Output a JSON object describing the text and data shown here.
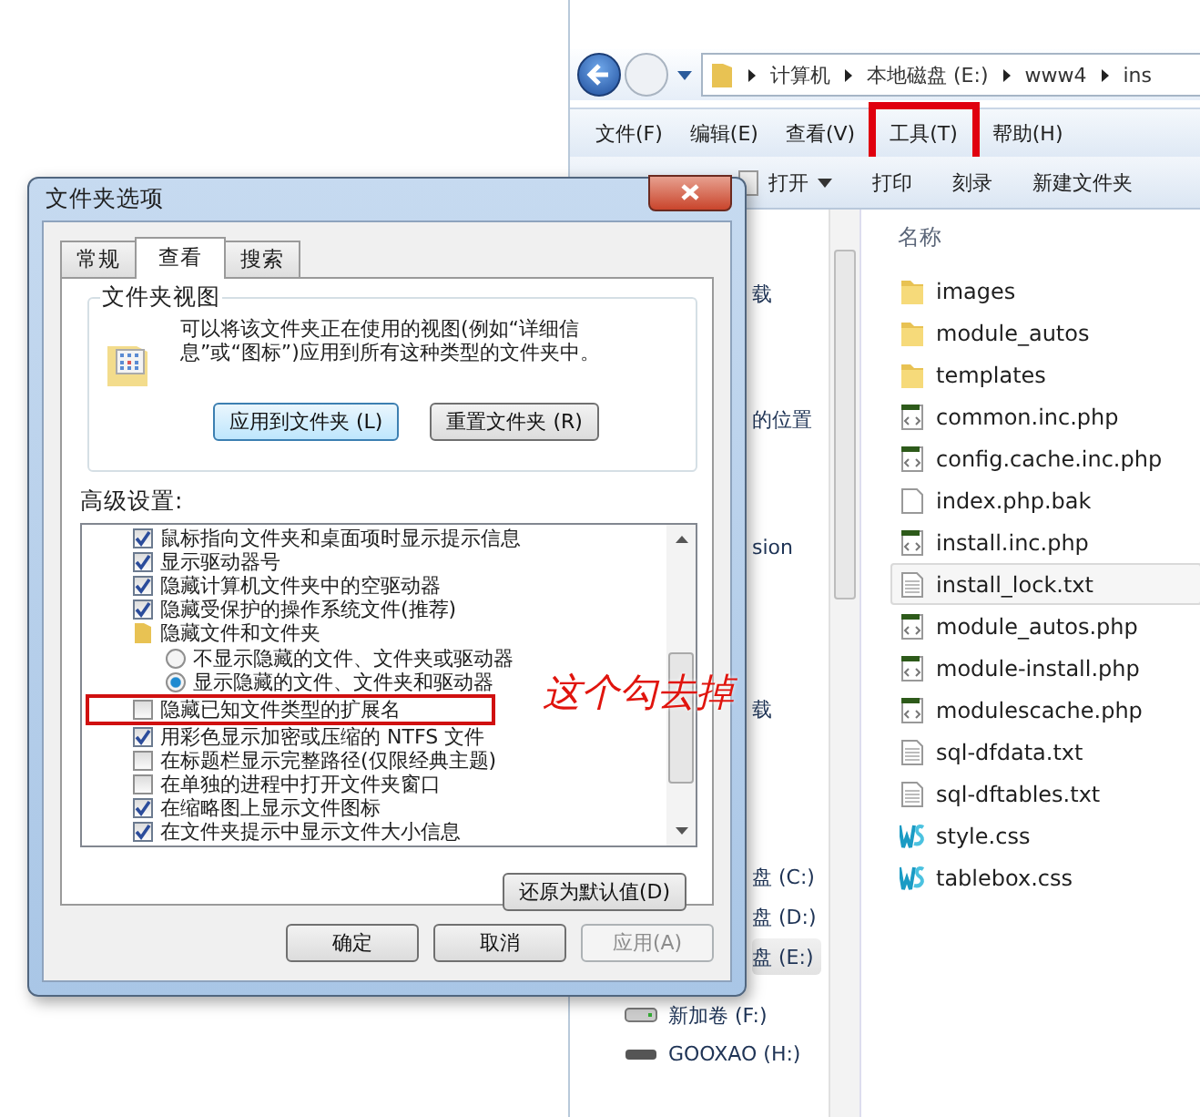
{
  "explorer": {
    "breadcrumb": [
      "计算机",
      "本地磁盘 (E:)",
      "www4",
      "ins"
    ],
    "menu": [
      {
        "label": "文件(F)",
        "highlighted": false
      },
      {
        "label": "编辑(E)",
        "highlighted": false
      },
      {
        "label": "查看(V)",
        "highlighted": false
      },
      {
        "label": "工具(T)",
        "highlighted": true
      },
      {
        "label": "帮助(H)",
        "highlighted": false
      }
    ],
    "toolbar": [
      {
        "label": "打开",
        "dropdown": true
      },
      {
        "label": "打印",
        "dropdown": false
      },
      {
        "label": "刻录",
        "dropdown": false
      },
      {
        "label": "新建文件夹",
        "dropdown": false
      }
    ],
    "nav_items": [
      {
        "label": "载",
        "kind": "text",
        "selected": false
      },
      {
        "label": "的位置",
        "kind": "text",
        "selected": false
      },
      {
        "label": "sion",
        "kind": "text",
        "selected": false
      },
      {
        "label": "载",
        "kind": "text",
        "selected": false
      },
      {
        "label": "盘 (C:)",
        "kind": "text",
        "selected": false
      },
      {
        "label": "盘 (D:)",
        "kind": "text",
        "selected": false
      },
      {
        "label": "盘 (E:)",
        "kind": "text",
        "selected": true
      },
      {
        "label": "新加卷 (F:)",
        "kind": "drive",
        "selected": false
      },
      {
        "label": "GOOXAO (H:)",
        "kind": "removable",
        "selected": false
      }
    ],
    "column_header": "名称",
    "files": [
      {
        "name": "images",
        "kind": "folder",
        "selected": false
      },
      {
        "name": "module_autos",
        "kind": "folder",
        "selected": false
      },
      {
        "name": "templates",
        "kind": "folder",
        "selected": false
      },
      {
        "name": "common.inc.php",
        "kind": "php",
        "selected": false
      },
      {
        "name": "config.cache.inc.php",
        "kind": "php",
        "selected": false
      },
      {
        "name": "index.php.bak",
        "kind": "blank",
        "selected": false
      },
      {
        "name": "install.inc.php",
        "kind": "php",
        "selected": false
      },
      {
        "name": "install_lock.txt",
        "kind": "text",
        "selected": true
      },
      {
        "name": "module_autos.php",
        "kind": "php",
        "selected": false
      },
      {
        "name": "module-install.php",
        "kind": "php",
        "selected": false
      },
      {
        "name": "modulescache.php",
        "kind": "php",
        "selected": false
      },
      {
        "name": "sql-dfdata.txt",
        "kind": "text",
        "selected": false
      },
      {
        "name": "sql-dftables.txt",
        "kind": "text",
        "selected": false
      },
      {
        "name": "style.css",
        "kind": "css",
        "selected": false
      },
      {
        "name": "tablebox.css",
        "kind": "css",
        "selected": false
      }
    ]
  },
  "dialog": {
    "title": "文件夹选项",
    "tabs": [
      {
        "label": "常规",
        "selected": false
      },
      {
        "label": "查看",
        "selected": true
      },
      {
        "label": "搜索",
        "selected": false
      }
    ],
    "folder_views": {
      "legend": "文件夹视图",
      "description": "可以将该文件夹正在使用的视图(例如“详细信息”或“图标”)应用到所有这种类型的文件夹中。",
      "buttons": [
        {
          "label": "应用到文件夹 (L)",
          "focused": true
        },
        {
          "label": "重置文件夹 (R)",
          "focused": false
        }
      ]
    },
    "advanced_label": "高级设置:",
    "advanced": [
      {
        "kind": "checkbox",
        "label": "鼠标指向文件夹和桌面项时显示提示信息",
        "checked": true
      },
      {
        "kind": "checkbox",
        "label": "显示驱动器号",
        "checked": true
      },
      {
        "kind": "checkbox",
        "label": "隐藏计算机文件夹中的空驱动器",
        "checked": true
      },
      {
        "kind": "checkbox",
        "label": "隐藏受保护的操作系统文件(推荐)",
        "checked": true
      },
      {
        "kind": "folder",
        "label": "隐藏文件和文件夹",
        "children": [
          {
            "kind": "radio",
            "label": "不显示隐藏的文件、文件夹或驱动器",
            "selected": false
          },
          {
            "kind": "radio",
            "label": "显示隐藏的文件、文件夹和驱动器",
            "selected": true
          }
        ]
      },
      {
        "kind": "checkbox",
        "label": "隐藏已知文件类型的扩展名",
        "checked": false,
        "highlighted": true
      },
      {
        "kind": "checkbox",
        "label": "用彩色显示加密或压缩的 NTFS 文件",
        "checked": true
      },
      {
        "kind": "checkbox",
        "label": "在标题栏显示完整路径(仅限经典主题)",
        "checked": false
      },
      {
        "kind": "checkbox",
        "label": "在单独的进程中打开文件夹窗口",
        "checked": false
      },
      {
        "kind": "checkbox",
        "label": "在缩略图上显示文件图标",
        "checked": true
      },
      {
        "kind": "checkbox",
        "label": "在文件夹提示中显示文件大小信息",
        "checked": true
      }
    ],
    "restore_button": "还原为默认值(D)",
    "buttons": [
      {
        "label": "确定",
        "disabled": false
      },
      {
        "label": "取消",
        "disabled": false
      },
      {
        "label": "应用(A)",
        "disabled": true
      }
    ]
  },
  "annotation": "这个勾去掉"
}
